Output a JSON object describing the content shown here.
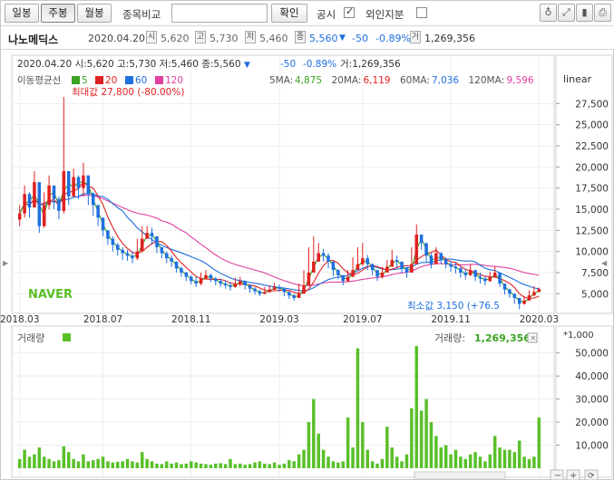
{
  "toolbar": {
    "btn_day": "일봉",
    "btn_week": "주봉",
    "btn_month": "월봉",
    "compare_label": "종목비교",
    "compare_placeholder": "",
    "confirm": "확인",
    "disclosure": "공시",
    "foreign": "외인지분"
  },
  "info": {
    "name": "나노메딕스",
    "date": "2020.04.20",
    "open": "5,620",
    "high": "5,730",
    "low": "5,460",
    "close": "5,560",
    "change": "-50",
    "change_pct": "-0.89%",
    "volume": "1,269,356",
    "b_open": "시",
    "b_high": "고",
    "b_low": "저",
    "b_close": "종",
    "b_vol": "거"
  },
  "chart_header": {
    "line": "2020.04.20 시:5,620 고:5,730 저:5,460 종:5,560",
    "change": "-50",
    "change_pct": "-0.89%",
    "vol": "거:1,269,356"
  },
  "ma": {
    "label": "이동평균선",
    "scale": "linear",
    "legend": [
      {
        "name": "5",
        "color": "#3aa320"
      },
      {
        "name": "20",
        "color": "#e02020"
      },
      {
        "name": "60",
        "color": "#1f6fe0"
      },
      {
        "name": "120",
        "color": "#e040a0"
      }
    ],
    "values": [
      {
        "name": "5MA:",
        "value": "4,875",
        "color": "#3aa320"
      },
      {
        "name": "20MA:",
        "value": "6,119",
        "color": "#e02020"
      },
      {
        "name": "60MA:",
        "value": "7,036",
        "color": "#1f6fe0"
      },
      {
        "name": "120MA:",
        "value": "9,596",
        "color": "#e040a0"
      }
    ]
  },
  "annotations": {
    "max": "최대값 27,800 (-80.00%)",
    "min": "최소값 3,150 (+76.5",
    "logo": "NAVER"
  },
  "volume_panel": {
    "label": "거래량",
    "vol_label": "거래량:",
    "vol_value": "1,269,356",
    "unit": "*1,000"
  },
  "colors": {
    "up": "#e02020",
    "down": "#1f6fe0",
    "ma5": "#3aa320",
    "ma20": "#e02020",
    "ma60": "#1f6fe0",
    "ma120": "#e040a0",
    "volume": "#5ac02a"
  },
  "chart_data": {
    "type": "candlestick",
    "y_ticks": [
      27500,
      25000,
      22500,
      20000,
      17500,
      15000,
      12500,
      10000,
      7500,
      5000
    ],
    "y_tick_labels": [
      "27,500",
      "25,000",
      "22,500",
      "20,000",
      "17,500",
      "15,000",
      "12,500",
      "10,000",
      "7,500",
      "5,000"
    ],
    "ylim": [
      3000,
      28500
    ],
    "x_ticks": [
      {
        "i": 0,
        "label": "2018.03"
      },
      {
        "i": 17,
        "label": "2018.07"
      },
      {
        "i": 35,
        "label": "2018.11"
      },
      {
        "i": 53,
        "label": "2019.03"
      },
      {
        "i": 70,
        "label": "2019.07"
      },
      {
        "i": 88,
        "label": "2019.11"
      },
      {
        "i": 106,
        "label": "2020.03"
      }
    ],
    "vol_ticks": [
      50000,
      40000,
      30000,
      20000,
      10000
    ],
    "vol_tick_labels": [
      "50,000",
      "40,000",
      "30,000",
      "20,000",
      "10,000"
    ],
    "vol_ylim": [
      0,
      55000
    ],
    "close": [
      14500,
      16800,
      15200,
      18200,
      13000,
      15500,
      17800,
      16200,
      14800,
      19500,
      16500,
      18800,
      17500,
      19000,
      16800,
      15500,
      14000,
      12500,
      11500,
      10800,
      10200,
      9800,
      9500,
      9200,
      10000,
      11500,
      12200,
      11800,
      10500,
      9800,
      9200,
      8800,
      8000,
      7500,
      7000,
      6500,
      6200,
      6800,
      7200,
      6800,
      6500,
      6200,
      6000,
      5800,
      6200,
      6500,
      6000,
      5600,
      5300,
      5000,
      5200,
      5500,
      5800,
      5600,
      5200,
      4800,
      4500,
      5000,
      6000,
      7500,
      8800,
      9800,
      9500,
      8800,
      7800,
      7200,
      6500,
      7000,
      7800,
      8500,
      9200,
      8500,
      7800,
      7000,
      7500,
      8200,
      9000,
      8800,
      8000,
      7500,
      8500,
      12000,
      11000,
      9500,
      8500,
      9800,
      9000,
      8500,
      8200,
      8000,
      7500,
      7200,
      7800,
      7000,
      6800,
      6500,
      7000,
      7500,
      6200,
      5500,
      5000,
      4500,
      3800,
      4200,
      4800,
      5200,
      5560
    ],
    "high": [
      15500,
      17800,
      17000,
      19500,
      16000,
      17000,
      19000,
      17500,
      16500,
      27800,
      18500,
      19800,
      19000,
      20500,
      18000,
      17000,
      15500,
      13500,
      12500,
      11800,
      11000,
      10500,
      10200,
      10000,
      11500,
      13000,
      13000,
      12800,
      11500,
      10500,
      10000,
      9500,
      8800,
      8200,
      7600,
      7200,
      7000,
      7500,
      7800,
      7400,
      7000,
      6800,
      6600,
      6400,
      6900,
      7000,
      6600,
      6100,
      5800,
      5500,
      5800,
      6000,
      6300,
      6100,
      5700,
      5300,
      5000,
      6200,
      7800,
      10500,
      11800,
      11000,
      10300,
      9800,
      8500,
      7900,
      7200,
      7800,
      9300,
      10500,
      11000,
      9600,
      8600,
      7800,
      8200,
      9000,
      10200,
      9500,
      8700,
      8200,
      10500,
      13200,
      12000,
      10500,
      9800,
      10500,
      9900,
      9300,
      8900,
      8700,
      8200,
      7900,
      8500,
      7800,
      7500,
      7100,
      7600,
      8200,
      7000,
      6200,
      5600,
      5000,
      4300,
      4700,
      5400,
      5900,
      5730
    ],
    "low": [
      13000,
      14000,
      14000,
      15800,
      12200,
      12800,
      15000,
      15000,
      13800,
      14500,
      15500,
      16500,
      16200,
      16500,
      15500,
      14200,
      13000,
      11800,
      10800,
      10000,
      9500,
      9000,
      8900,
      8600,
      9000,
      10500,
      11500,
      10800,
      9800,
      9200,
      8600,
      8200,
      7500,
      7000,
      6500,
      6100,
      5800,
      6000,
      6700,
      6400,
      6000,
      5800,
      5600,
      5400,
      5700,
      5900,
      5500,
      5100,
      4900,
      4700,
      4900,
      5100,
      5400,
      5200,
      4700,
      4400,
      4200,
      4500,
      5300,
      6800,
      8000,
      9200,
      8800,
      8000,
      7100,
      6700,
      6000,
      6400,
      7000,
      7900,
      8300,
      7800,
      7200,
      6500,
      6800,
      7500,
      8300,
      8100,
      7400,
      6900,
      7500,
      9000,
      10200,
      8800,
      8000,
      8800,
      8500,
      8000,
      7600,
      7400,
      6900,
      6700,
      7100,
      6500,
      6200,
      6000,
      6400,
      6900,
      5800,
      4900,
      4500,
      3800,
      3150,
      3700,
      4200,
      4700,
      5460
    ],
    "volume": [
      4000,
      8000,
      5000,
      6000,
      9000,
      5000,
      4000,
      3000,
      3500,
      9500,
      7000,
      4000,
      3000,
      6000,
      3000,
      3500,
      4000,
      5000,
      3000,
      2500,
      2800,
      3000,
      4000,
      3000,
      2500,
      7000,
      4000,
      3000,
      2000,
      1800,
      3000,
      2000,
      2500,
      1800,
      2000,
      3000,
      2500,
      2000,
      1800,
      1500,
      2000,
      2200,
      1800,
      4000,
      1800,
      2000,
      1500,
      1800,
      2500,
      3000,
      2000,
      1800,
      2500,
      1500,
      2000,
      3500,
      3000,
      6000,
      8000,
      20000,
      30000,
      15000,
      8000,
      5000,
      3000,
      2500,
      3000,
      22000,
      9000,
      52000,
      20000,
      8000,
      3000,
      2000,
      4000,
      18000,
      9000,
      5000,
      3000,
      6000,
      26000,
      53000,
      25000,
      30000,
      20000,
      14000,
      9000,
      10000,
      6000,
      8000,
      5000,
      4000,
      6000,
      7000,
      5000,
      3000,
      6000,
      14000,
      9000,
      8000,
      8000,
      7000,
      12000,
      5000,
      4000,
      5000,
      22000
    ]
  }
}
